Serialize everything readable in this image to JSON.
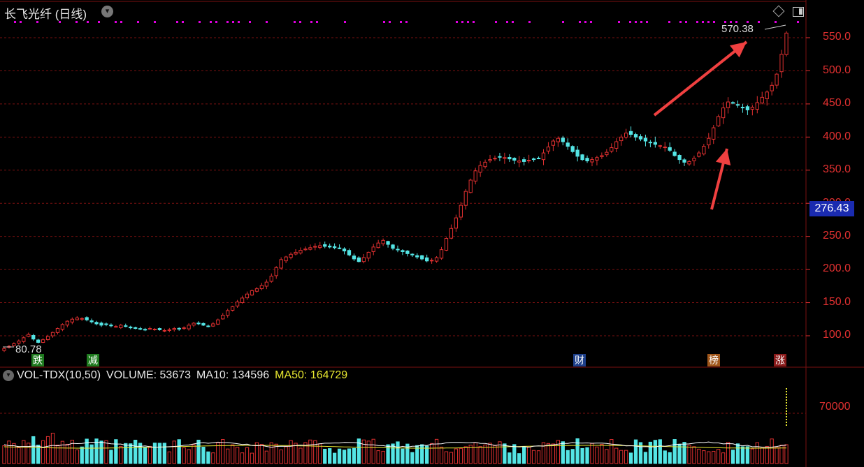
{
  "header": {
    "title": "长飞光纤 (日线)",
    "menu_icon": "chevron-down-icon",
    "right_icons": [
      "diamond-icon",
      "panel-toggle-icon"
    ]
  },
  "price_axis": {
    "ticks": [
      "550.0",
      "500.0",
      "450.0",
      "400.0",
      "350.0",
      "300.0",
      "250.0",
      "200.0",
      "150.0",
      "100.0"
    ],
    "current_price": "276.43"
  },
  "annotations": {
    "peak_label": "570.38",
    "low_label": "80.78"
  },
  "event_badges": [
    {
      "label": "跌",
      "color": "#1e7a1e"
    },
    {
      "label": "减",
      "color": "#1e7a1e"
    },
    {
      "label": "财",
      "color": "#1d3f8a"
    },
    {
      "label": "榜",
      "color": "#a0561a"
    },
    {
      "label": "涨",
      "color": "#8a1a1a"
    }
  ],
  "volume_panel": {
    "indicator": "VOL-TDX(10,50)",
    "volume_label": "VOLUME:",
    "volume_value": "53673",
    "ma10_label": "MA10:",
    "ma10_value": "134596",
    "ma50_label": "MA50:",
    "ma50_value": "164729",
    "axis_tick": "70000"
  },
  "colors": {
    "up": "#e03030",
    "down": "#54e5e5",
    "grid": "#7a1010",
    "ma50": "#e8e830",
    "ma10": "#ffffff",
    "marker": "#e000e0",
    "arrow": "#f04040"
  },
  "chart_data": [
    {
      "type": "candlestick",
      "title": "长飞光纤 (日线)",
      "ylim": [
        60,
        580
      ],
      "y_ticks": [
        100,
        150,
        200,
        250,
        300,
        350,
        400,
        450,
        500,
        550
      ],
      "close": [
        80.78,
        84,
        88,
        92,
        97,
        102,
        95,
        90,
        94,
        99,
        105,
        111,
        117,
        122,
        125,
        127,
        126,
        124,
        121,
        118,
        116,
        117,
        115,
        114,
        116,
        114,
        112,
        111,
        110,
        109,
        111,
        110,
        109,
        108,
        109,
        111,
        110,
        112,
        116,
        119,
        118,
        116,
        114,
        118,
        124,
        131,
        138,
        144,
        151,
        157,
        163,
        168,
        171,
        176,
        181,
        190,
        203,
        215,
        219,
        223,
        226,
        229,
        231,
        233,
        235,
        236,
        235,
        234,
        233,
        232,
        228,
        222,
        216,
        212,
        218,
        226,
        234,
        240,
        244,
        238,
        232,
        230,
        227,
        224,
        222,
        219,
        216,
        213,
        214,
        218,
        230,
        247,
        262,
        278,
        297,
        318,
        335,
        349,
        357,
        362,
        366,
        368,
        370,
        369,
        367,
        365,
        364,
        363,
        365,
        366,
        368,
        376,
        385,
        394,
        398,
        393,
        386,
        378,
        371,
        366,
        364,
        366,
        369,
        372,
        377,
        384,
        393,
        400,
        406,
        404,
        400,
        397,
        394,
        392,
        389,
        387,
        385,
        380,
        372,
        366,
        362,
        363,
        368,
        376,
        386,
        398,
        414,
        431,
        444,
        453,
        452,
        448,
        444,
        441,
        445,
        452,
        460,
        468,
        478,
        495,
        525,
        557
      ],
      "series": [
        {
          "name": "VOLUME",
          "last": 53673
        },
        {
          "name": "MA10",
          "last": 134596
        },
        {
          "name": "MA50",
          "last": 164729
        }
      ],
      "peak": 570.38,
      "low": 80.78,
      "current_price": 276.43
    }
  ]
}
